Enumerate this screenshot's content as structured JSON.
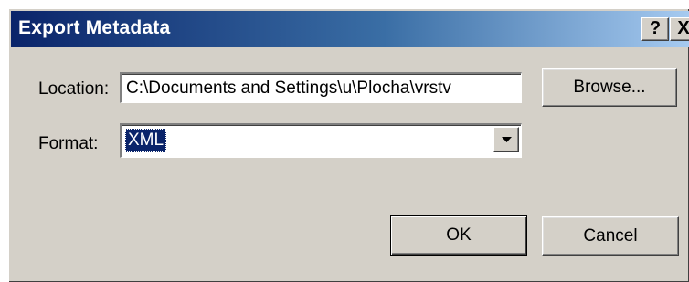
{
  "window": {
    "title": "Export Metadata",
    "help_label": "?",
    "close_label": "X"
  },
  "location": {
    "label": "Location:",
    "value": "C:\\Documents and Settings\\u\\Plocha\\vrstv"
  },
  "browse_button": {
    "label": "Browse..."
  },
  "format": {
    "label": "Format:",
    "selected": "XML"
  },
  "buttons": {
    "ok": "OK",
    "cancel": "Cancel"
  },
  "colors": {
    "dialog_face": "#d4d0c8",
    "titlebar_start": "#0a246a",
    "titlebar_end": "#a6caf0",
    "selection": "#0a246a"
  }
}
